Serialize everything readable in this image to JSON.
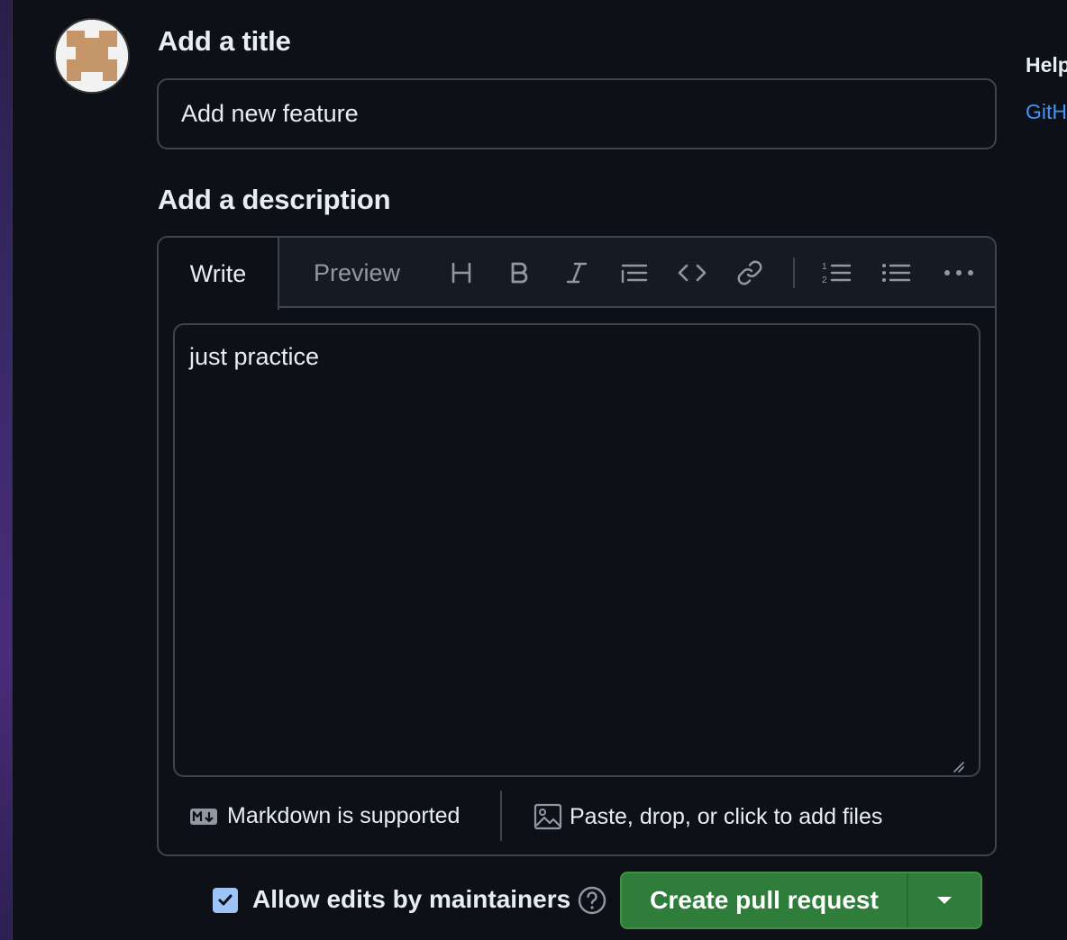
{
  "form": {
    "title_label": "Add a title",
    "title_value": "Add new feature",
    "description_label": "Add a description"
  },
  "editor": {
    "tabs": [
      {
        "label": "Write",
        "active": true
      },
      {
        "label": "Preview",
        "active": false
      }
    ],
    "toolbar_icons": [
      "heading-icon",
      "bold-icon",
      "italic-icon",
      "quote-icon",
      "code-icon",
      "link-icon",
      "numbered-list-icon",
      "bulleted-list-icon",
      "more-icon"
    ],
    "body_text": "just practice",
    "markdown_note": "Markdown is supported",
    "attach_note": "Paste, drop, or click to add files"
  },
  "actions": {
    "allow_edits_label": "Allow edits by maintainers",
    "allow_edits_checked": true,
    "create_label": "Create pull request"
  },
  "sidebar": {
    "heading": "Help",
    "link": "GitHub"
  },
  "colors": {
    "background": "#0d1117",
    "accent_green": "#2f7d3a",
    "link_blue": "#4493f8",
    "checkbox": "#9cc4f7"
  }
}
